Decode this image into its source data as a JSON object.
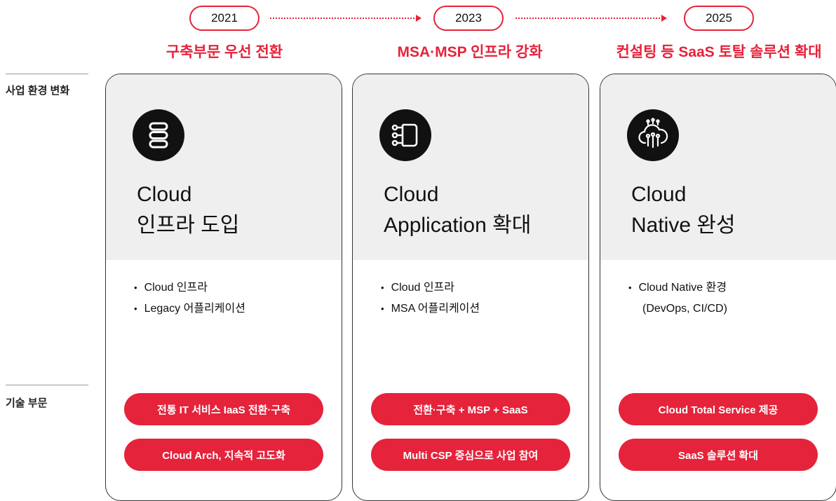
{
  "timeline": {
    "years": [
      "2021",
      "2023",
      "2025"
    ],
    "phases": [
      "구축부문 우선 전환",
      "MSA·MSP 인프라 강화",
      "컨설팅 등 SaaS 토탈 솔루션 확대"
    ]
  },
  "row_labels": {
    "business": "사업 환경 변화",
    "tech": "기술 부문"
  },
  "cards": [
    {
      "icon": "server-stack-icon",
      "heading_line1": "Cloud",
      "heading_line2": "인프라 도입",
      "bullets": [
        "Cloud 인프라",
        "Legacy 어플리케이션"
      ],
      "tech": [
        "전통 IT 서비스 IaaS 전환·구축",
        "Cloud Arch, 지속적 고도화"
      ]
    },
    {
      "icon": "application-nodes-icon",
      "heading_line1": "Cloud",
      "heading_line2": "Application 확대",
      "bullets": [
        "Cloud 인프라",
        "MSA 어플리케이션"
      ],
      "tech": [
        "전환·구축 + MSP + SaaS",
        "Multi CSP 중심으로 사업 참여"
      ]
    },
    {
      "icon": "cloud-network-icon",
      "heading_line1": "Cloud",
      "heading_line2": "Native 완성",
      "bullets": [
        "Cloud Native 환경",
        "(DevOps, CI/CD)"
      ],
      "tech": [
        "Cloud Total Service 제공",
        "SaaS 솔루션 확대"
      ]
    }
  ],
  "colors": {
    "accent": "#e5233b",
    "card_top_bg": "#efefef",
    "icon_bg": "#111111"
  }
}
